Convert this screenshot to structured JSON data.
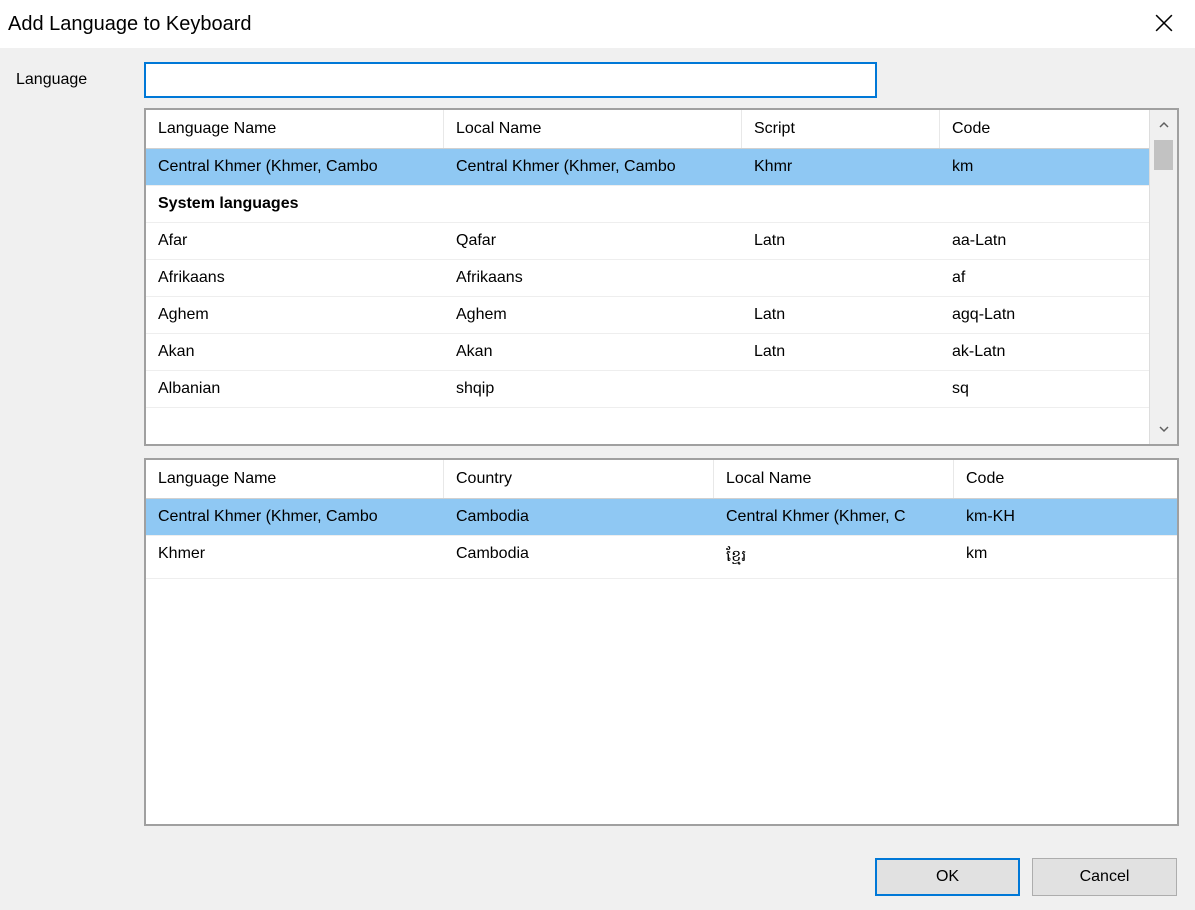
{
  "dialog": {
    "title": "Add Language to Keyboard",
    "language_label": "Language",
    "search_value": "",
    "ok_label": "OK",
    "cancel_label": "Cancel"
  },
  "top_table": {
    "headers": [
      "Language Name",
      "Local Name",
      "Script",
      "Code"
    ],
    "rows": [
      {
        "type": "data",
        "selected": true,
        "cells": [
          "Central Khmer (Khmer, Cambo",
          "Central Khmer (Khmer, Cambo",
          "Khmr",
          "km"
        ]
      },
      {
        "type": "group",
        "selected": false,
        "cells": [
          "System languages",
          "",
          "",
          ""
        ]
      },
      {
        "type": "data",
        "selected": false,
        "cells": [
          "Afar",
          "Qafar",
          "Latn",
          "aa-Latn"
        ]
      },
      {
        "type": "data",
        "selected": false,
        "cells": [
          "Afrikaans",
          "Afrikaans",
          "",
          "af"
        ]
      },
      {
        "type": "data",
        "selected": false,
        "cells": [
          "Aghem",
          "Aghem",
          "Latn",
          "agq-Latn"
        ]
      },
      {
        "type": "data",
        "selected": false,
        "cells": [
          "Akan",
          "Akan",
          "Latn",
          "ak-Latn"
        ]
      },
      {
        "type": "data",
        "selected": false,
        "cells": [
          "Albanian",
          "shqip",
          "",
          "sq"
        ]
      }
    ]
  },
  "bottom_table": {
    "headers": [
      "Language Name",
      "Country",
      "Local Name",
      "Code"
    ],
    "rows": [
      {
        "selected": true,
        "cells": [
          "Central Khmer (Khmer, Cambo",
          "Cambodia",
          "Central Khmer (Khmer, C",
          "km-KH"
        ]
      },
      {
        "selected": false,
        "cells": [
          "Khmer",
          "Cambodia",
          "ខ្មែរ",
          "km"
        ]
      }
    ]
  }
}
